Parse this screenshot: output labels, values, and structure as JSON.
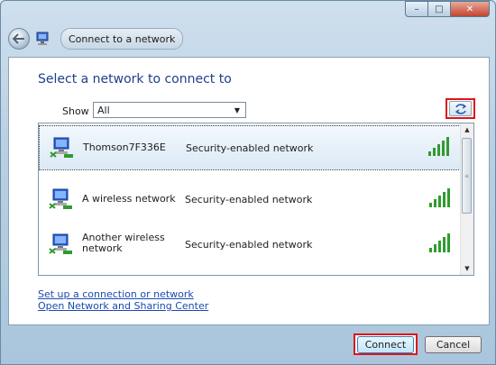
{
  "window": {
    "caption_buttons": {
      "minimize": "–",
      "maximize": "□",
      "close": "✕"
    },
    "nav_title": "Connect to a network",
    "icons": {
      "back": "back-arrow-icon",
      "network": "network-icon"
    }
  },
  "main": {
    "heading": "Select a network to connect to",
    "show": {
      "label": "Show",
      "value": "All"
    },
    "refresh_icon": "refresh-icon",
    "networks": [
      {
        "name": "Thomson7F336E",
        "security": "Security-enabled network",
        "signal_bars": 5,
        "selected": true
      },
      {
        "name": "A wireless network",
        "security": "Security-enabled network",
        "signal_bars": 5,
        "selected": false
      },
      {
        "name": "Another wireless network",
        "security": "Security-enabled network",
        "signal_bars": 5,
        "selected": false
      }
    ],
    "links": {
      "setup": "Set up a connection or network",
      "sharing_center": "Open Network and Sharing Center"
    }
  },
  "footer": {
    "connect_label": "Connect",
    "cancel_label": "Cancel"
  },
  "colors": {
    "heading": "#1f3f8c",
    "link": "#1a4bb0",
    "highlight": "#e0141a",
    "signal": "#2f9b2f"
  }
}
